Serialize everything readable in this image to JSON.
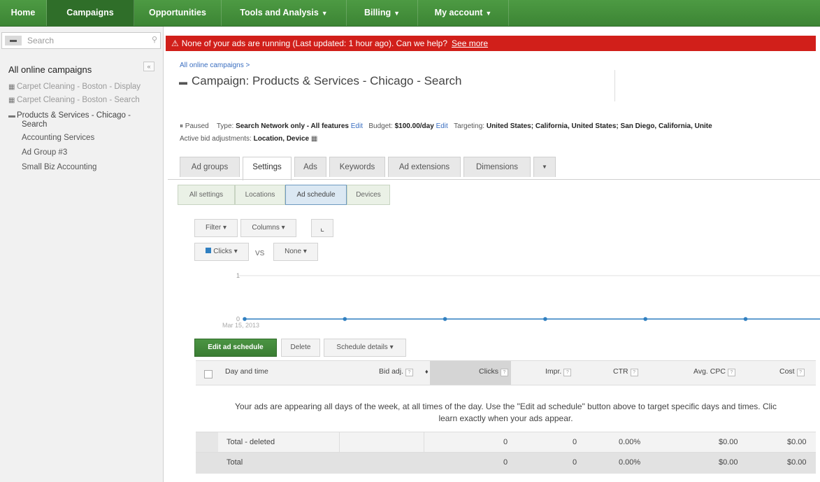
{
  "nav": {
    "items": [
      {
        "label": "Home",
        "caret": ""
      },
      {
        "label": "Campaigns",
        "caret": ""
      },
      {
        "label": "Opportunities",
        "caret": ""
      },
      {
        "label": "Tools and Analysis",
        "caret": "▼"
      },
      {
        "label": "Billing",
        "caret": "▼"
      },
      {
        "label": "My account",
        "caret": "▼"
      }
    ]
  },
  "sidebar": {
    "search_placeholder": "Search",
    "title": "All online campaigns",
    "campaigns": [
      {
        "label": "Carpet Cleaning - Boston - Display"
      },
      {
        "label": "Carpet Cleaning - Boston - Search"
      },
      {
        "label": "Products & Services - Chicago -",
        "label2": "Search"
      }
    ],
    "ad_groups": [
      "Accounting Services",
      "Ad Group #3",
      "Small Biz Accounting"
    ]
  },
  "alert": {
    "text": "None of your ads are running (Last updated: 1 hour ago). Can we help?",
    "link": "See more"
  },
  "header": {
    "breadcrumb": "All online campaigns >",
    "campaign_prefix": "Campaign:",
    "campaign_name": "Products & Services - Chicago - Search"
  },
  "status": {
    "state": "Paused",
    "type_label": "Type:",
    "type_value": "Search Network only - All features",
    "edit": "Edit",
    "budget_label": "Budget:",
    "budget_value": "$100.00/day",
    "targeting_label": "Targeting:",
    "targeting_value": "United States; California, United States; San Diego, California, Unite",
    "bid_label": "Active bid adjustments:",
    "bid_value": "Location, Device"
  },
  "tabs": [
    "Ad groups",
    "Settings",
    "Ads",
    "Keywords",
    "Ad extensions",
    "Dimensions",
    "▼"
  ],
  "subtabs": [
    "All settings",
    "Locations",
    "Ad schedule",
    "Devices"
  ],
  "controls": {
    "filter": "Filter ▾",
    "columns": "Columns ▾",
    "metric1": "Clicks ▾",
    "vs": "VS",
    "metric2": "None ▾"
  },
  "chart_data": {
    "type": "line",
    "x": [
      "Mar 15, 2013",
      "",
      "",
      "",
      "",
      "",
      ""
    ],
    "series": [
      {
        "values": [
          0,
          0,
          0,
          0,
          0,
          0,
          0
        ],
        "color": "#2f7fc1"
      }
    ],
    "y_ticks": [
      "1",
      "0"
    ],
    "x_tick_label": "Mar 15, 2013",
    "ylim": [
      0,
      1
    ]
  },
  "actions": {
    "edit_schedule": "Edit ad schedule",
    "delete": "Delete",
    "schedule_details": "Schedule details ▾"
  },
  "table": {
    "columns": [
      "Day and time",
      "Bid adj.",
      "Clicks",
      "Impr.",
      "CTR",
      "Avg. CPC",
      "Cost"
    ],
    "sort_indicator": "♦",
    "message_line1": "Your ads are appearing all days of the week, at all times of the day. Use the \"Edit ad schedule\" button above to target specific days and times. Clic",
    "message_line2": "learn exactly when your ads appear.",
    "rows": [
      {
        "label": "Total - deleted",
        "clicks": "0",
        "impr": "0",
        "ctr": "0.00%",
        "cpc": "$0.00",
        "cost": "$0.00"
      },
      {
        "label": "Total",
        "clicks": "0",
        "impr": "0",
        "ctr": "0.00%",
        "cpc": "$0.00",
        "cost": "$0.00"
      }
    ]
  }
}
